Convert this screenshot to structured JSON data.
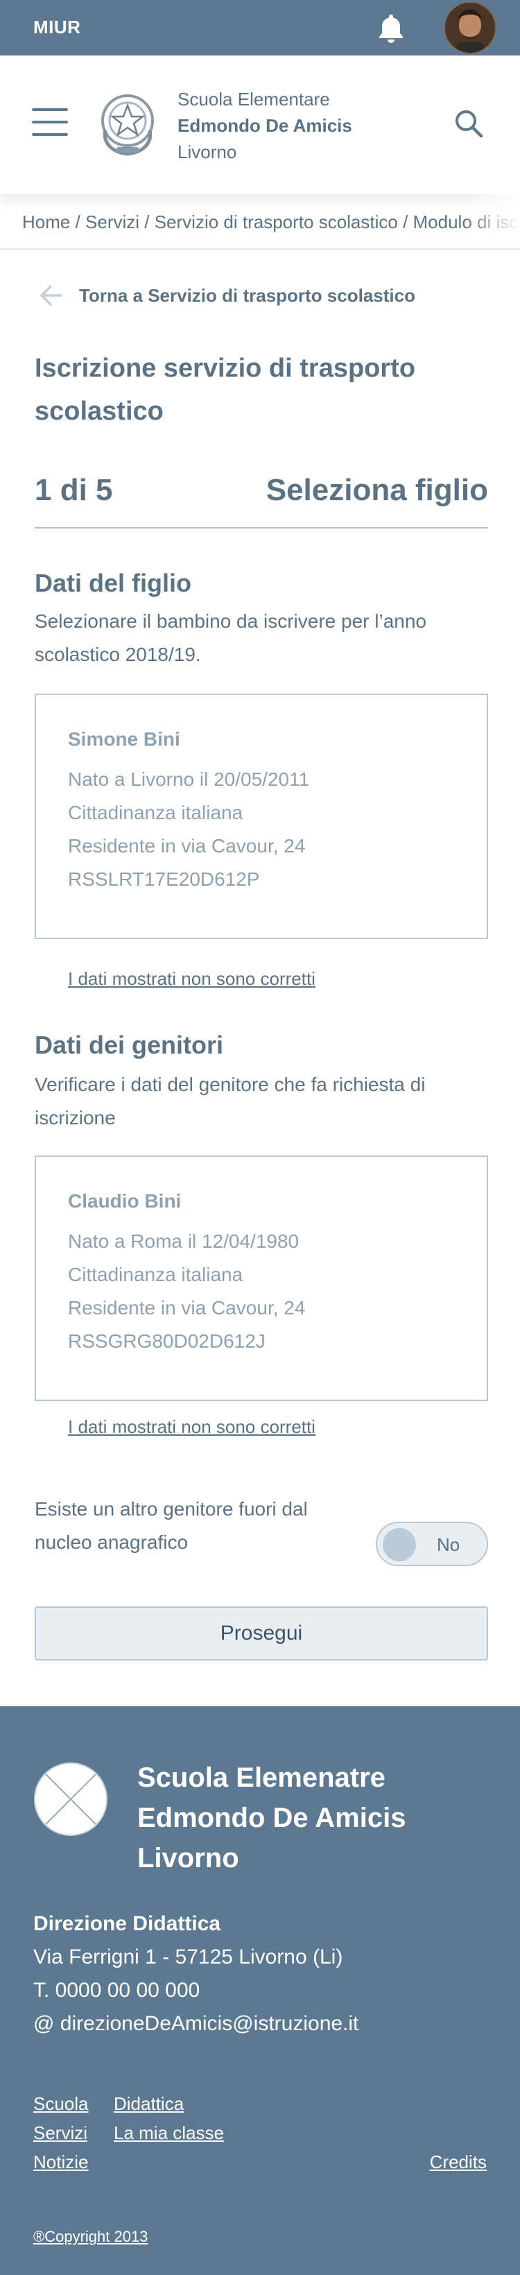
{
  "topbar": {
    "brand": "MIUR",
    "notification_icon": "bell-icon",
    "avatar": "user-avatar"
  },
  "header": {
    "menu_icon": "hamburger-menu-icon",
    "emblem_icon": "italian-republic-emblem-icon",
    "school_line1": "Scuola Elementare",
    "school_line2": "Edmondo De Amicis",
    "school_line3": "Livorno",
    "search_icon": "search-icon"
  },
  "breadcrumb": {
    "text": "Home / Servizi / Servizio di trasporto scolastico / Modulo di iscrizione"
  },
  "back_link": {
    "icon": "arrow-left-icon",
    "label": "Torna a Servizio di trasporto scolastico"
  },
  "page": {
    "title": "Iscrizione servizio di trasporto scolastico",
    "step": "1 di 5",
    "step_label": "Seleziona figlio"
  },
  "child_section": {
    "title": "Dati del figlio",
    "description": "Selezionare il bambino da iscrivere per l’anno scolastico 2018/19.",
    "card": {
      "name": "Simone Bini",
      "birth": "Nato a Livorno il 20/05/2011",
      "citizenship": "Cittadinanza italiana",
      "residence": "Residente in via Cavour, 24",
      "tax_code": "RSSLRT17E20D612P"
    },
    "wrong_link": "I dati mostrati non sono corretti"
  },
  "parent_section": {
    "title": "Dati dei genitori",
    "description": "Verificare i dati del genitore che fa richiesta di iscrizione",
    "card": {
      "name": "Claudio Bini",
      "birth": "Nato a Roma il 12/04/1980",
      "citizenship": "Cittadinanza italiana",
      "residence": "Residente in via Cavour, 24",
      "tax_code": "RSSGRG80D02D612J"
    },
    "wrong_link": "I dati mostrati non sono corretti"
  },
  "other_parent": {
    "label": "Esiste un altro genitore fuori dal nucleo anagrafico",
    "toggle_value": "No"
  },
  "actions": {
    "next_label": "Prosegui"
  },
  "footer": {
    "logo_icon": "placeholder-logo-icon",
    "title_line1": "Scuola Elemenatre",
    "title_line2": "Edmondo De Amicis",
    "title_line3": "Livorno",
    "office": "Direzione Didattica",
    "address": "Via Ferrigni 1 - 57125 Livorno (Li)",
    "phone": "T. 0000 00 00 000",
    "email": "@ direzioneDeAmicis@istruzione.it",
    "links": {
      "scuola": "Scuola",
      "didattica": "Didattica",
      "servizi": "Servizi",
      "la_mia_classe": "La mia classe",
      "notizie": "Notizie",
      "credits": "Credits"
    },
    "copyright": "®Copyright 2013"
  },
  "colors": {
    "primary": "#5c7991",
    "text": "#5b7285",
    "muted_text": "#8ea1b0",
    "border": "#b6c8d6",
    "button_bg": "#e9eef3"
  }
}
